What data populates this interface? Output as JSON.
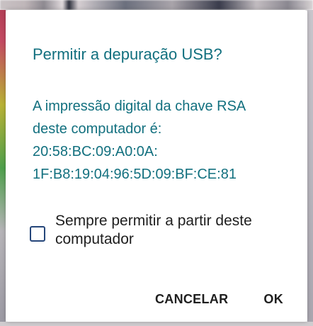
{
  "dialog": {
    "title": "Permitir a depuração USB?",
    "message_lines": [
      "A impressão digital da chave RSA",
      "deste computador é:",
      "20:58:BC:09:A0:0A:",
      "1F:B8:19:04:96:5D:09:BF:CE:81"
    ],
    "checkbox": {
      "checked": false,
      "label_lines": [
        "Sempre permitir a partir deste",
        "computador"
      ]
    },
    "cancel_label": "CANCELAR",
    "ok_label": "OK"
  },
  "colors": {
    "title": "#12707f",
    "message": "#12707f",
    "checkbox_border": "#25467a",
    "text": "#1e1e1e"
  }
}
